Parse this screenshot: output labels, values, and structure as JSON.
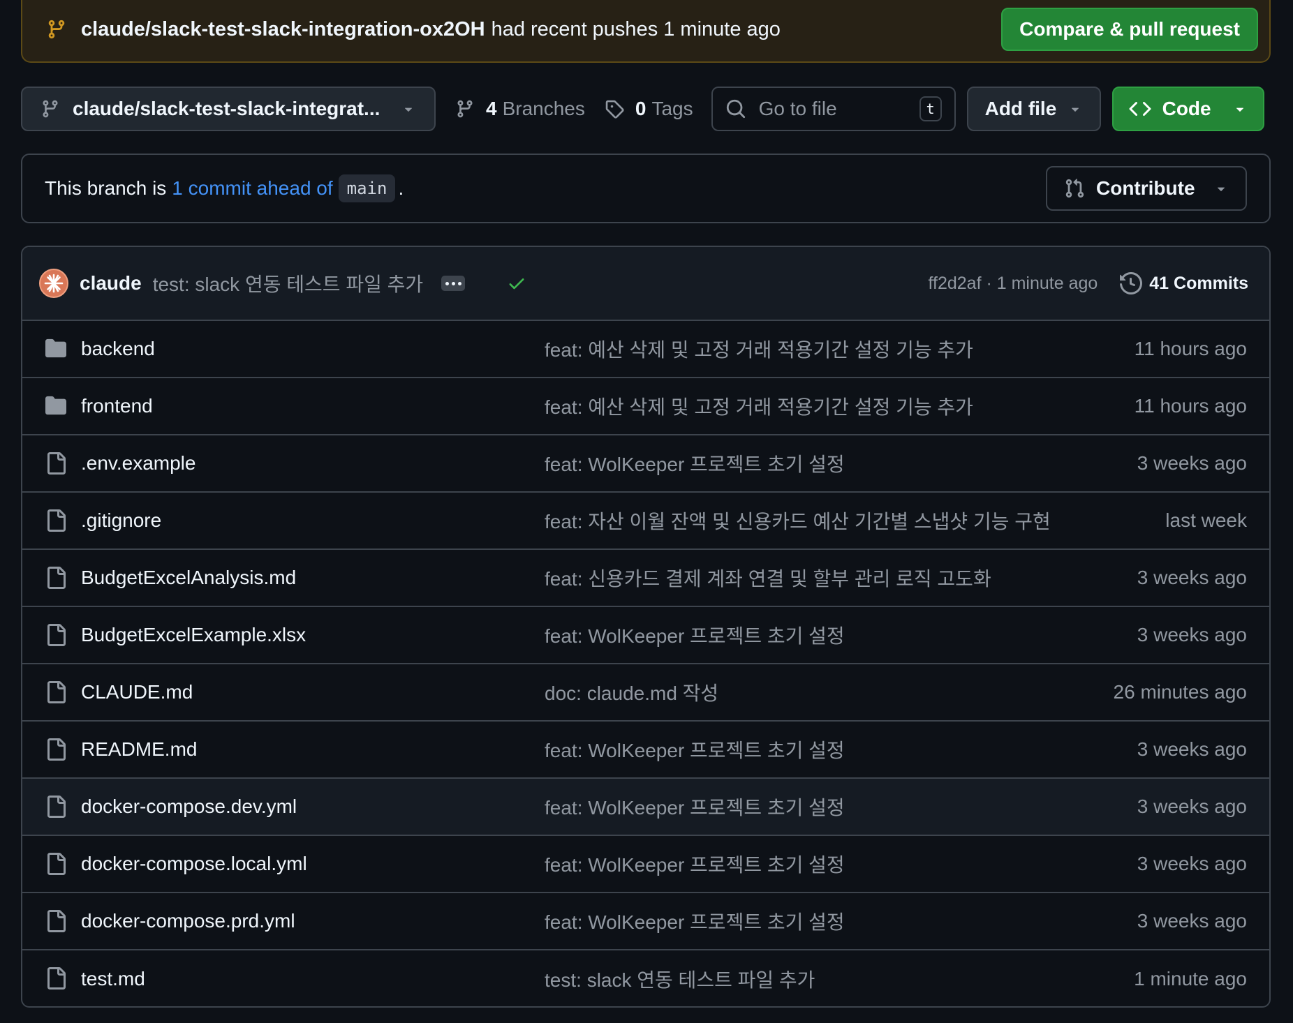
{
  "banner": {
    "branch": "claude/slack-test-slack-integration-ox2OH",
    "text": "had recent pushes 1 minute ago",
    "compare_button": "Compare & pull request"
  },
  "toolbar": {
    "branch_label": "claude/slack-test-slack-integrat...",
    "branches_count": "4",
    "branches_label": "Branches",
    "tags_count": "0",
    "tags_label": "Tags",
    "search_placeholder": "Go to file",
    "search_shortcut": "t",
    "add_file_label": "Add file",
    "code_label": "Code"
  },
  "ahead": {
    "prefix": "This branch is",
    "link": "1 commit ahead of",
    "base": "main",
    "suffix": ".",
    "contribute_label": "Contribute"
  },
  "latest_commit": {
    "author": "claude",
    "message": "test: slack 연동 테스트 파일 추가",
    "sha_time": "ff2d2af · 1 minute ago",
    "commits_label": "41 Commits"
  },
  "files": [
    {
      "name": "backend",
      "type": "folder",
      "message": "feat: 예산 삭제 및 고정 거래 적용기간 설정 기능 추가",
      "time": "11 hours ago"
    },
    {
      "name": "frontend",
      "type": "folder",
      "message": "feat: 예산 삭제 및 고정 거래 적용기간 설정 기능 추가",
      "time": "11 hours ago"
    },
    {
      "name": ".env.example",
      "type": "file",
      "message": "feat: WolKeeper 프로젝트 초기 설정",
      "time": "3 weeks ago"
    },
    {
      "name": ".gitignore",
      "type": "file",
      "message": "feat: 자산 이월 잔액 및 신용카드 예산 기간별 스냅샷 기능 구현",
      "time": "last week"
    },
    {
      "name": "BudgetExcelAnalysis.md",
      "type": "file",
      "message": "feat: 신용카드 결제 계좌 연결 및 할부 관리 로직 고도화",
      "time": "3 weeks ago"
    },
    {
      "name": "BudgetExcelExample.xlsx",
      "type": "file",
      "message": "feat: WolKeeper 프로젝트 초기 설정",
      "time": "3 weeks ago"
    },
    {
      "name": "CLAUDE.md",
      "type": "file",
      "message": "doc: claude.md 작성",
      "time": "26 minutes ago"
    },
    {
      "name": "README.md",
      "type": "file",
      "message": "feat: WolKeeper 프로젝트 초기 설정",
      "time": "3 weeks ago"
    },
    {
      "name": "docker-compose.dev.yml",
      "type": "file",
      "message": "feat: WolKeeper 프로젝트 초기 설정",
      "time": "3 weeks ago"
    },
    {
      "name": "docker-compose.local.yml",
      "type": "file",
      "message": "feat: WolKeeper 프로젝트 초기 설정",
      "time": "3 weeks ago"
    },
    {
      "name": "docker-compose.prd.yml",
      "type": "file",
      "message": "feat: WolKeeper 프로젝트 초기 설정",
      "time": "3 weeks ago"
    },
    {
      "name": "test.md",
      "type": "file",
      "message": "test: slack 연동 테스트 파일 추가",
      "time": "1 minute ago"
    }
  ],
  "icons": {
    "branch": "git-branch-icon",
    "tag": "tag-icon",
    "search": "search-icon",
    "code": "code-icon",
    "contribute": "git-pull-request-icon",
    "history": "history-icon",
    "folder": "folder-icon",
    "file": "file-icon",
    "check": "check-icon"
  },
  "colors": {
    "background": "#0d1117",
    "accent_green": "#238636",
    "link_blue": "#4493f8",
    "banner_bg": "#272115",
    "muted": "#9198a1"
  }
}
